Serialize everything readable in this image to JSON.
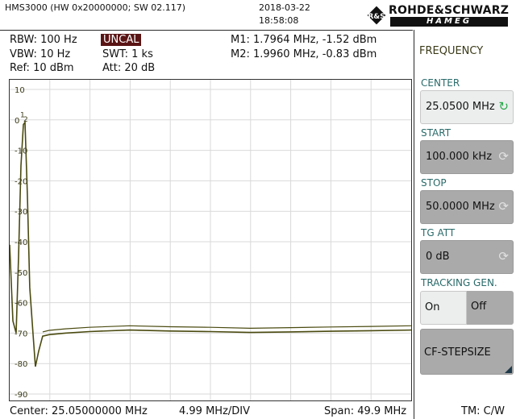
{
  "header": {
    "device": "HMS3000 (HW 0x20000000; SW 02.117)",
    "date": "2018-03-22",
    "time": "18:58:08",
    "logo_top": "ROHDE&SCHWARZ",
    "logo_bottom": "HAMEG"
  },
  "settings": {
    "rbw": "RBW: 100 Hz",
    "vbw": "VBW: 10 Hz",
    "ref": "Ref: 10 dBm",
    "uncal": "UNCAL",
    "swt": "SWT: 1 ks",
    "att": "Att: 20 dB"
  },
  "markers": {
    "m1": "M1: 1.7964 MHz, -1.52 dBm",
    "m2": "M2: 1.9960 MHz, -0.83 dBm"
  },
  "menu": {
    "title": "FREQUENCY",
    "center_label": "CENTER",
    "center_value": "25.0500 MHz",
    "start_label": "START",
    "start_value": "100.000 kHz",
    "stop_label": "STOP",
    "stop_value": "50.0000 MHz",
    "tgatt_label": "TG ATT",
    "tgatt_value": "0 dB",
    "tracking_label": "TRACKING GEN.",
    "tracking_on": "On",
    "tracking_off": "Off",
    "cfstep_label": "CF-STEPSIZE"
  },
  "footer": {
    "center": "Center: 25.05000000 MHz",
    "div": "4.99 MHz/DIV",
    "span": "Span: 49.9 MHz",
    "tm": "TM: C/W"
  },
  "colors": {
    "trace": "#4a4a10",
    "grid": "#d9d9d9",
    "accent_label": "#2a6a6a",
    "refresh_icon": "#2aa84a"
  },
  "chart_data": {
    "type": "line",
    "y_ticks": [
      "10",
      "0",
      "-10",
      "-20",
      "-30",
      "-40",
      "-50",
      "-60",
      "-70",
      "-80",
      "-90"
    ],
    "ylim": [
      -90,
      10
    ],
    "xlim": [
      0.1,
      50.0
    ],
    "x_unit": "MHz",
    "y_unit": "dBm",
    "grid": true,
    "series": [
      {
        "x": [
          0.1,
          0.5,
          0.9,
          1.2,
          1.5,
          1.8,
          2.0,
          2.3,
          2.6,
          3.0,
          3.3,
          3.7,
          4.2,
          5.0,
          7.0,
          10.0,
          15.0,
          20.0,
          25.0,
          30.0,
          35.0,
          40.0,
          45.0,
          50.0
        ],
        "y": [
          -41,
          -66,
          -70,
          -45,
          -15,
          -1.5,
          -0.8,
          -25,
          -55,
          -70,
          -81,
          -76,
          -71,
          -70.5,
          -70,
          -69.5,
          -69,
          -69.3,
          -69.5,
          -69.8,
          -69.6,
          -69.4,
          -69.2,
          -69
        ]
      }
    ]
  }
}
